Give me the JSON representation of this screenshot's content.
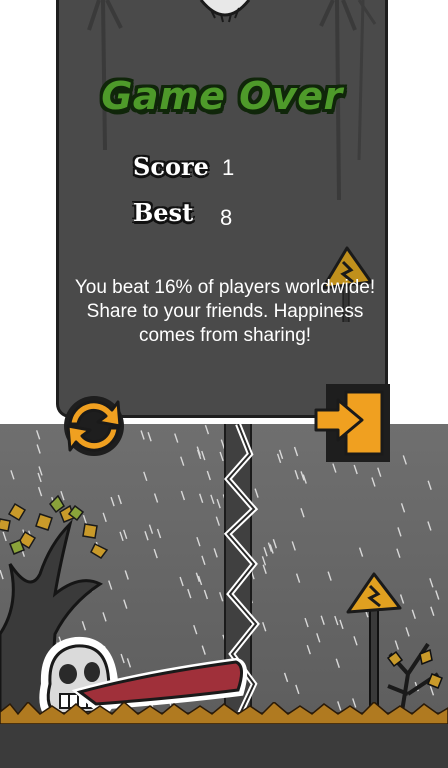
{
  "game_over": {
    "title": "Game Over",
    "score_label": "Score",
    "score_value": "1",
    "best_label": "Best",
    "best_value": "8",
    "message_line1": "You beat 16% of players worldwide!",
    "message_line2": "Share to your friends. Happiness",
    "message_line3": "comes from sharing!"
  },
  "buttons": {
    "restart_icon": "restart-arrows-icon",
    "exit_icon": "exit-door-icon"
  },
  "colors": {
    "panel": "#4a4a4a",
    "title_green": "#4e9a2a",
    "button_orange": "#f0a020",
    "tongue_red": "#a0303a"
  }
}
